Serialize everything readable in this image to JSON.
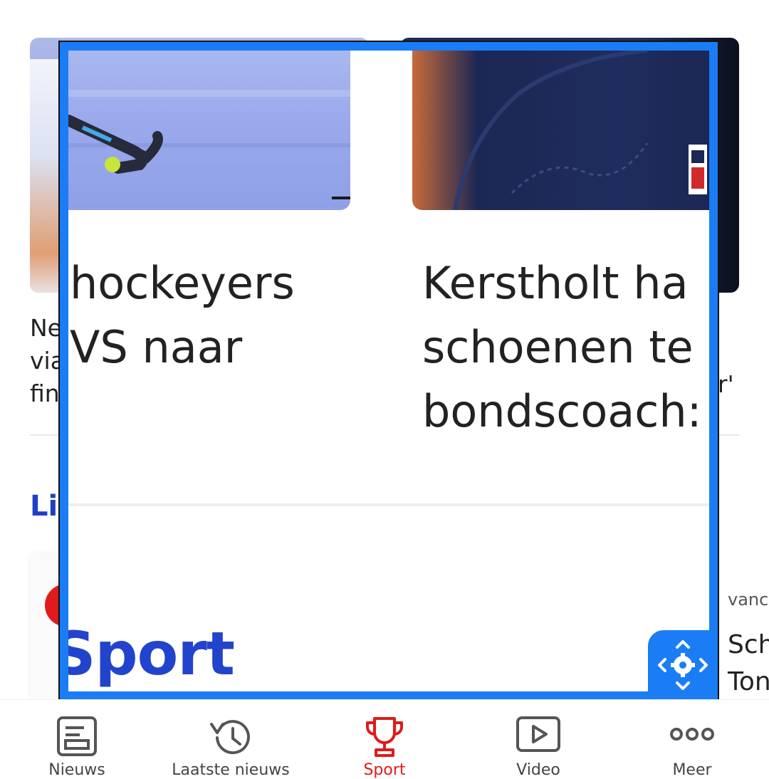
{
  "page": {
    "left_card": {
      "headline_visible": "Ne\nvia\nfin"
    },
    "right_card": {
      "headline_tail": "r'"
    },
    "section_title": "Li",
    "right_article": {
      "meta": "vanc",
      "title_lines": [
        "Sch",
        "Ton"
      ]
    }
  },
  "magnifier": {
    "left_headline_lines": [
      "hockeyers",
      "VS naar"
    ],
    "right_headline_lines": [
      "Kerstholt ha",
      "schoenen te",
      "bondscoach:"
    ],
    "sport_logo": "Sport",
    "control_icon": "move-settings-icon"
  },
  "bottom_nav": {
    "items": [
      {
        "label": "Nieuws",
        "icon": "newspaper-icon",
        "active": false
      },
      {
        "label": "Laatste nieuws",
        "icon": "history-icon",
        "active": false
      },
      {
        "label": "Sport",
        "icon": "trophy-icon",
        "active": true
      },
      {
        "label": "Video",
        "icon": "play-icon",
        "active": false
      },
      {
        "label": "Meer",
        "icon": "more-dots-icon",
        "active": false
      }
    ],
    "active_color": "#e01b1b"
  },
  "colors": {
    "magnifier_border": "#1a7df5",
    "sport_blue": "#2244cc",
    "section_blue": "#1f3fc7"
  }
}
